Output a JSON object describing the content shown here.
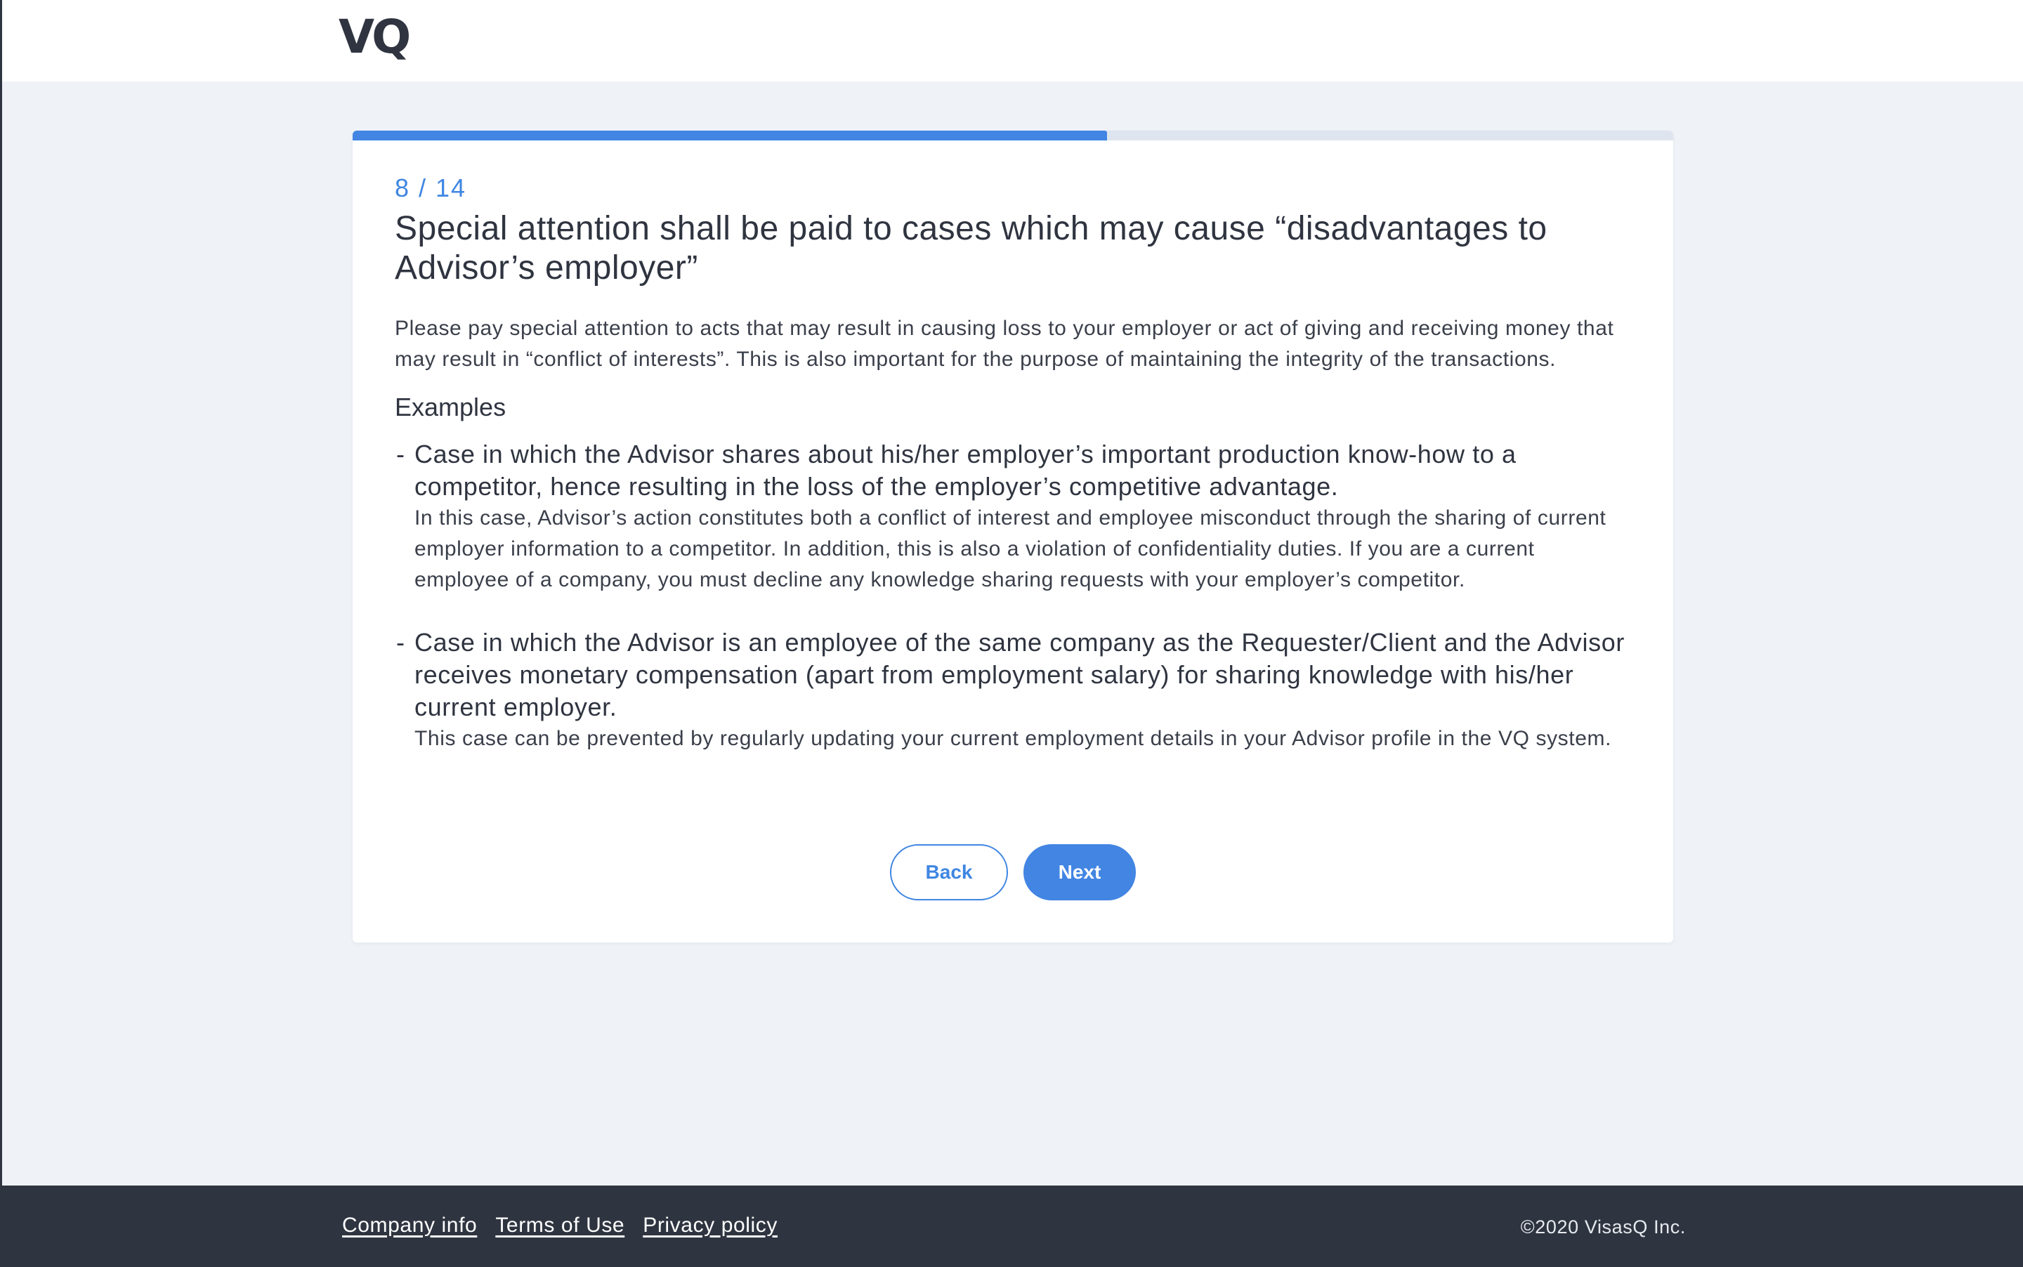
{
  "header": {
    "logo_text": "VQ"
  },
  "progress": {
    "current": 8,
    "total": 14,
    "fraction": 0.5714,
    "label": "8 / 14"
  },
  "main": {
    "title": "Special attention shall be paid to cases which may cause “disadvantages to Advisor’s employer”",
    "intro": "Please pay special attention to acts that may result in causing loss to your employer or act of giving and receiving money that may result in “conflict of interests”. This is also important for the purpose of maintaining the integrity of the transactions.",
    "examples_heading": "Examples",
    "dash": "-",
    "examples": [
      {
        "title": "Case in which the Advisor shares about his/her employer’s important production know-how to a competitor, hence resulting in the loss of the employer’s competitive advantage.",
        "body": "In this case, Advisor’s action constitutes both a conflict of interest and employee misconduct through the sharing of current employer information to a competitor. In addition, this is also a violation of confidentiality duties. If you are a current employee of a company, you must decline any knowledge sharing requests with your employer’s competitor."
      },
      {
        "title": "Case in which the Advisor is an employee of the same company as the Requester/Client and the Advisor receives monetary compensation (apart from employment salary) for sharing knowledge with his/her current employer.",
        "body": "This case can be prevented by regularly updating your current employment details in your Advisor profile in the VQ system."
      }
    ]
  },
  "buttons": {
    "back_label": "Back",
    "next_label": "Next"
  },
  "footer": {
    "links": [
      "Company info",
      "Terms of Use",
      "Privacy policy"
    ],
    "copyright": "©2020 VisasQ Inc."
  },
  "colors": {
    "accent": "#4285e3",
    "page_background": "#eff3f8",
    "footer_background": "#2f3540",
    "text": "#2f3440"
  }
}
